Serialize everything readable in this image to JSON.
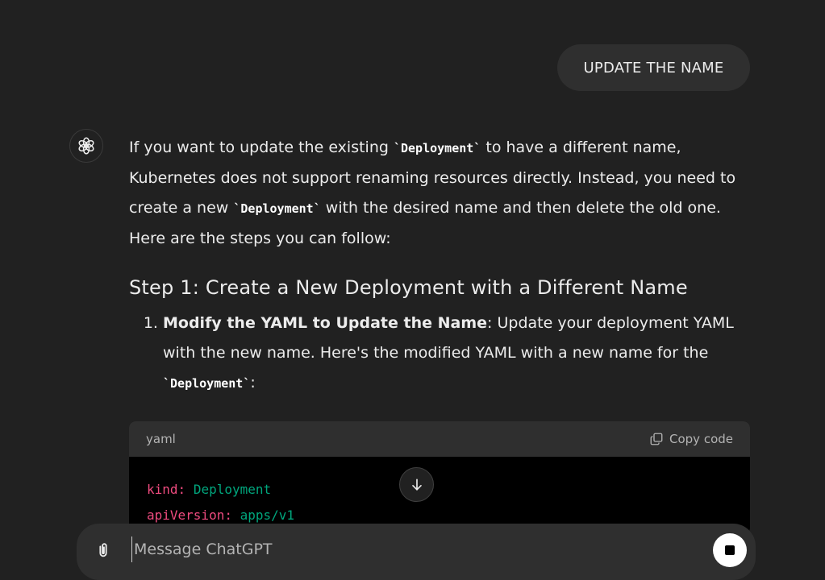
{
  "user_message": "UPDATE THE NAME",
  "assistant": {
    "intro": [
      {
        "t": "If you want to update the existing "
      },
      {
        "code": "`Deployment`"
      },
      {
        "t": " to have a different name, Kubernetes does not support renaming resources directly. Instead, you need to create a new "
      },
      {
        "code": "`Deployment`"
      },
      {
        "t": " with the desired name and then delete the old one. Here are the steps you can follow:"
      }
    ],
    "step_heading": "Step 1: Create a New Deployment with a Different Name",
    "steps": [
      {
        "bold": "Modify the YAML to Update the Name",
        "text": ": Update your deployment YAML with the new name. Here's the modified YAML with a new name for the ",
        "code": "`Deployment`",
        "tail": ":"
      }
    ]
  },
  "code_block": {
    "language": "yaml",
    "copy_label": "Copy code",
    "lines": [
      {
        "key": "kind:",
        "value": "Deployment"
      },
      {
        "key": "apiVersion:",
        "value": "apps/v1"
      }
    ]
  },
  "composer": {
    "placeholder": "Message ChatGPT"
  },
  "icons": {
    "avatar": "openai-logo-icon",
    "attach": "paperclip-icon",
    "copy": "copy-icon",
    "scroll": "arrow-down-icon",
    "stop": "stop-icon"
  },
  "colors": {
    "background": "#212121",
    "bubble": "#2f2f2f",
    "yaml_key": "#ef4b7f",
    "yaml_value": "#00a67d"
  }
}
